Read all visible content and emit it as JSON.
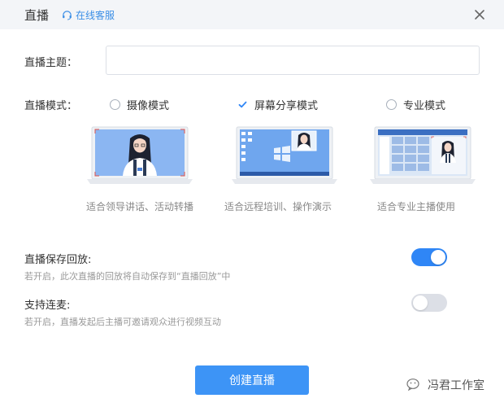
{
  "header": {
    "title": "直播",
    "customer_service": "在线客服",
    "close_icon": "close-icon"
  },
  "topic": {
    "label": "直播主题：",
    "value": "",
    "placeholder": ""
  },
  "mode": {
    "label": "直播模式：",
    "options": [
      {
        "label": "摄像模式",
        "caption": "适合领导讲话、活动转播",
        "selected": false
      },
      {
        "label": "屏幕分享模式",
        "caption": "适合远程培训、操作演示",
        "selected": true
      },
      {
        "label": "专业模式",
        "caption": "适合专业主播使用",
        "selected": false
      }
    ]
  },
  "playback": {
    "title": "直播保存回放:",
    "desc": "若开启，此次直播的回放将自动保存到“直播回放”中",
    "enabled": true
  },
  "mic_link": {
    "title": "支持连麦:",
    "desc": "若开启，直播发起后主播可邀请观众进行视频互动",
    "enabled": false
  },
  "create_button": "创建直播",
  "watermark": "冯君工作室",
  "colors": {
    "accent": "#3d94f6",
    "header_bg": "#f3f5f8",
    "toggle_off": "#dcdfe6"
  }
}
